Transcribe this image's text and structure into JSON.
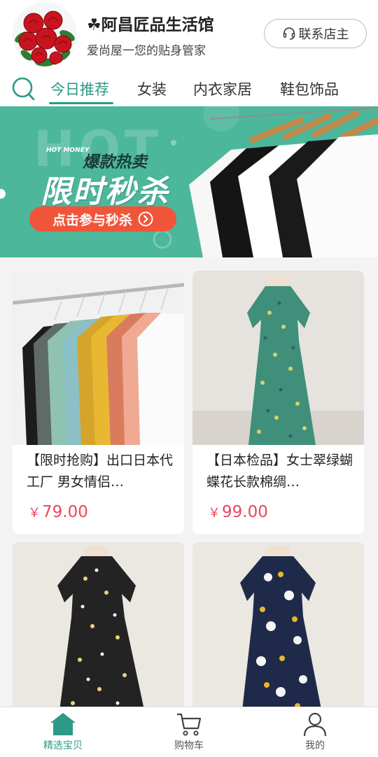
{
  "shop": {
    "name": "☘阿昌匠品生活馆",
    "slogan": "爱尚屋一您的贴身管家",
    "contact_label": "联系店主"
  },
  "tabs": [
    {
      "label": "今日推荐",
      "active": true
    },
    {
      "label": "女装",
      "active": false
    },
    {
      "label": "内衣家居",
      "active": false
    },
    {
      "label": "鞋包饰品",
      "active": false
    }
  ],
  "banner": {
    "bg_word": "HOT",
    "small_text": "HOT MONEY",
    "subtitle": "爆款热卖",
    "title": "限时秒杀",
    "button_label": "点击参与秒杀"
  },
  "products": [
    {
      "title": "【限时抢购】出口日本代工厂 男女情侣…",
      "currency": "￥",
      "price": "79.00"
    },
    {
      "title": "【日本检品】女士翠绿蝴蝶花长款棉绸…",
      "currency": "￥",
      "price": "99.00"
    },
    {
      "title": "",
      "currency": "",
      "price": ""
    },
    {
      "title": "",
      "currency": "",
      "price": ""
    }
  ],
  "bottom_nav": [
    {
      "label": "精选宝贝",
      "icon": "home-icon",
      "active": true
    },
    {
      "label": "购物车",
      "icon": "cart-icon",
      "active": false
    },
    {
      "label": "我的",
      "icon": "user-icon",
      "active": false
    }
  ],
  "colors": {
    "accent": "#2c9a86",
    "price": "#e9485c",
    "banner_bg": "#4cb79b",
    "banner_button": "#f0553a"
  }
}
